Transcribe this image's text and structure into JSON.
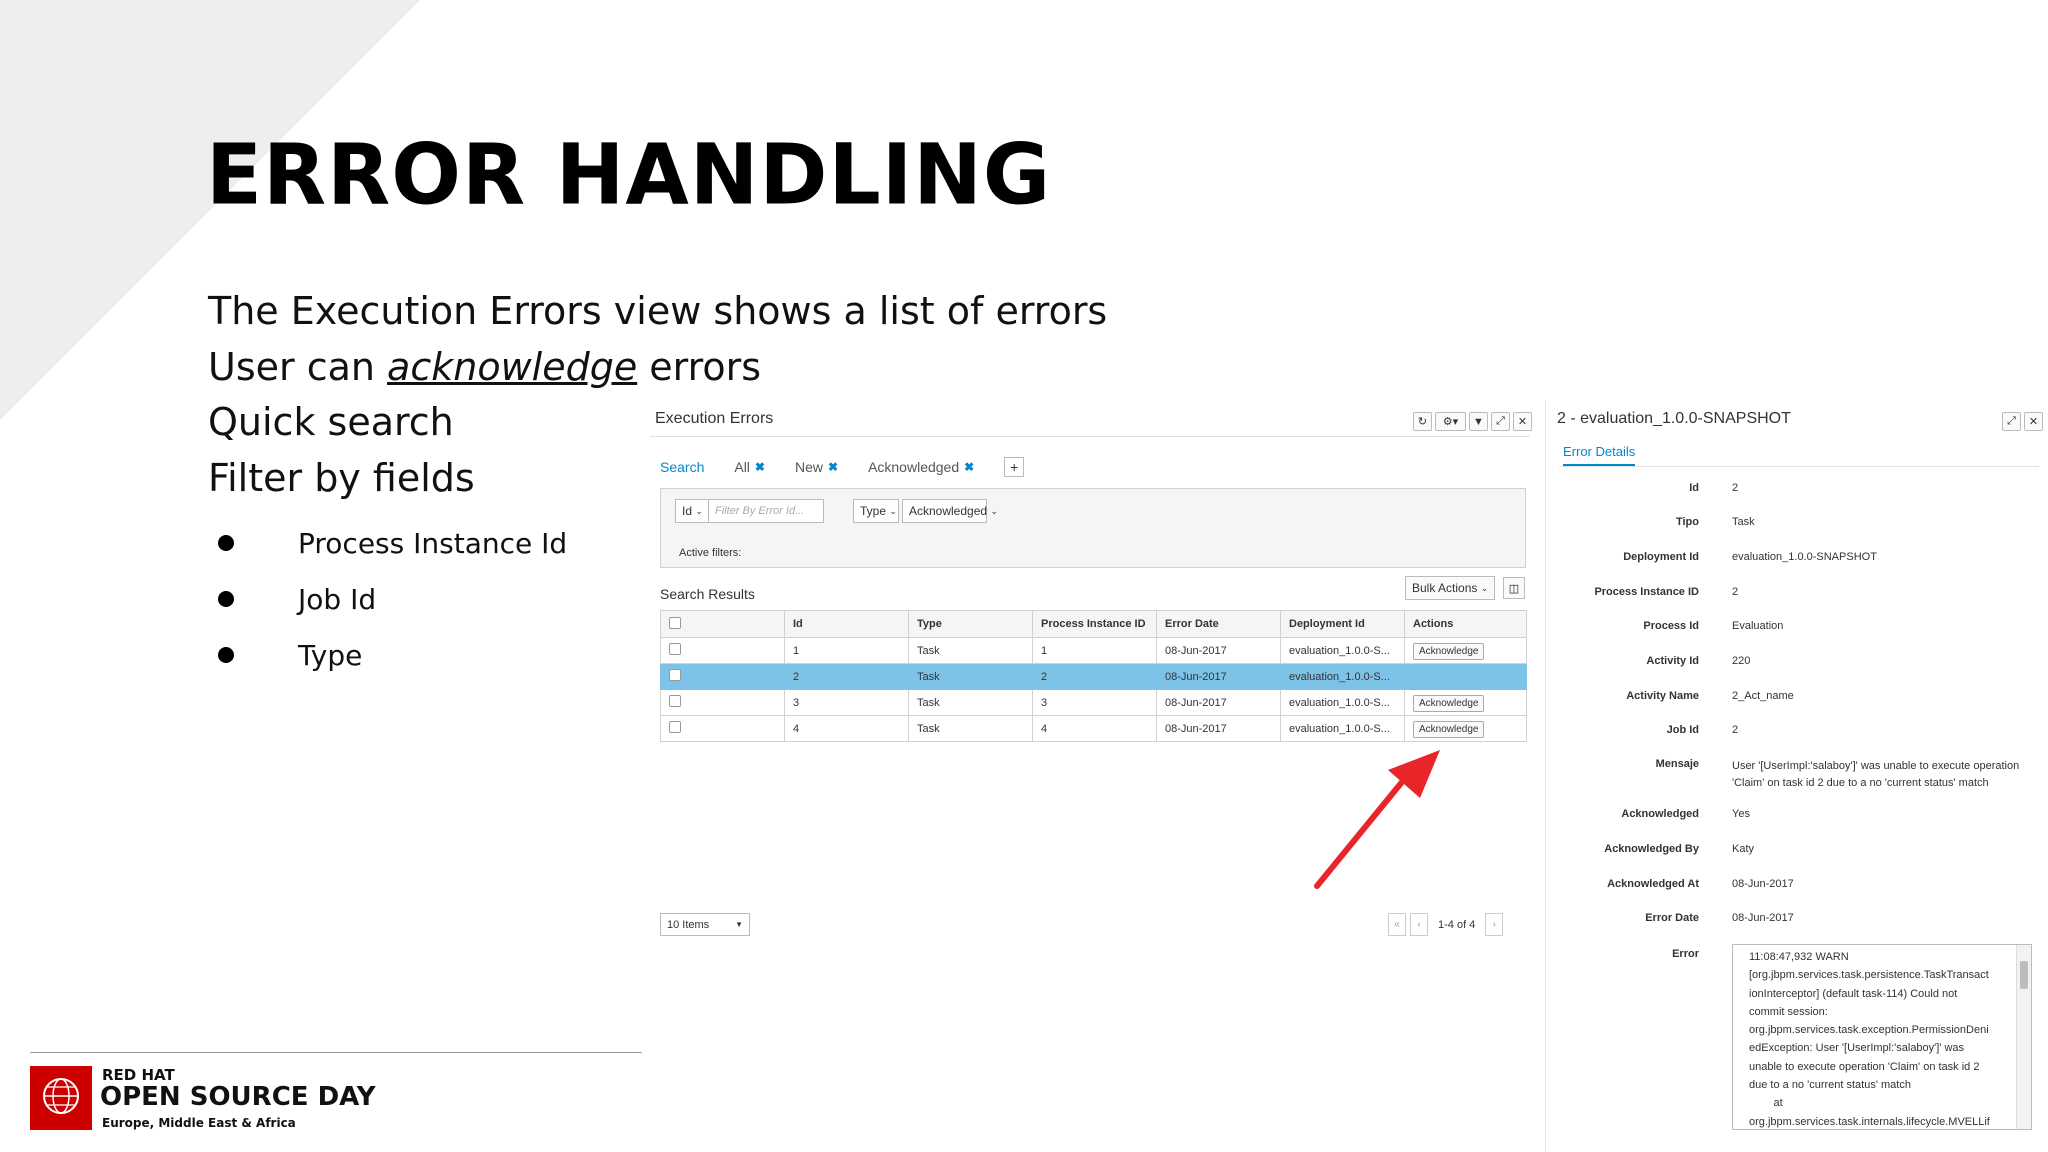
{
  "slide": {
    "title": "ERROR HANDLING",
    "bullet1": "The Execution Errors view shows a list of errors",
    "bullet2_pre": "User can ",
    "bullet2_em": "acknowledge",
    "bullet2_post": " errors",
    "bullet3": "Quick search",
    "bullet4": "Filter by fields",
    "sub_bullets": [
      "Process Instance Id",
      "Job Id",
      "Type"
    ]
  },
  "errors_panel": {
    "title": "Execution Errors",
    "tool_icons": [
      "refresh-icon",
      "gear-icon",
      "filter-icon",
      "expand-icon",
      "close-icon"
    ],
    "tabs": [
      {
        "label": "Search",
        "active": true,
        "closable": false
      },
      {
        "label": "All",
        "active": false,
        "closable": true
      },
      {
        "label": "New",
        "active": false,
        "closable": true
      },
      {
        "label": "Acknowledged",
        "active": false,
        "closable": true
      }
    ],
    "add_tab_label": "+",
    "filter": {
      "field_select": "Id",
      "input_placeholder": "Filter By Error Id...",
      "type_select": "Type",
      "ack_select": "Acknowledged",
      "active_filters_label": "Active filters:"
    },
    "search_results_label": "Search Results",
    "bulk_actions_label": "Bulk Actions",
    "columns": [
      "",
      "Id",
      "Type",
      "Process Instance ID",
      "Error Date",
      "Deployment Id",
      "Actions"
    ],
    "rows": [
      {
        "id": "1",
        "type": "Task",
        "pid": "1",
        "date": "08-Jun-2017",
        "deployment": "evaluation_1.0.0-S...",
        "action": "Acknowledge",
        "selected": false
      },
      {
        "id": "2",
        "type": "Task",
        "pid": "2",
        "date": "08-Jun-2017",
        "deployment": "evaluation_1.0.0-S...",
        "action": "",
        "selected": true
      },
      {
        "id": "3",
        "type": "Task",
        "pid": "3",
        "date": "08-Jun-2017",
        "deployment": "evaluation_1.0.0-S...",
        "action": "Acknowledge",
        "selected": false
      },
      {
        "id": "4",
        "type": "Task",
        "pid": "4",
        "date": "08-Jun-2017",
        "deployment": "evaluation_1.0.0-S...",
        "action": "Acknowledge",
        "selected": false
      }
    ],
    "page_size": "10 Items",
    "page_info": "1-4 of 4"
  },
  "details_panel": {
    "title": "2 - evaluation_1.0.0-SNAPSHOT",
    "tab": "Error Details",
    "fields": [
      {
        "label": "Id",
        "value": "2"
      },
      {
        "label": "Tipo",
        "value": "Task"
      },
      {
        "label": "Deployment Id",
        "value": "evaluation_1.0.0-SNAPSHOT"
      },
      {
        "label": "Process Instance ID",
        "value": "2"
      },
      {
        "label": "Process Id",
        "value": "Evaluation"
      },
      {
        "label": "Activity Id",
        "value": "220"
      },
      {
        "label": "Activity Name",
        "value": "2_Act_name"
      },
      {
        "label": "Job Id",
        "value": "2"
      },
      {
        "label": "Mensaje",
        "value": "User '[UserImpl:'salaboy']' was unable to execute operation 'Claim' on task id 2 due to a no 'current status' match"
      },
      {
        "label": "Acknowledged",
        "value": "Yes"
      },
      {
        "label": "Acknowledged By",
        "value": "Katy"
      },
      {
        "label": "Acknowledged At",
        "value": "08-Jun-2017"
      },
      {
        "label": "Error Date",
        "value": "08-Jun-2017"
      },
      {
        "label": "Error",
        "value": ""
      }
    ],
    "error_text": "11:08:47,932 WARN\n[org.jbpm.services.task.persistence.TaskTransact\nionInterceptor] (default task-114) Could not\ncommit session:\norg.jbpm.services.task.exception.PermissionDeni\nedException: User '[UserImpl:'salaboy']' was\nunable to execute operation 'Claim' on task id 2\ndue to a no 'current status' match\n        at\norg.jbpm.services.task.internals.lifecycle.MVELLif"
  },
  "footer": {
    "brand_line1": "RED HAT",
    "brand_line2": "OPEN SOURCE DAY",
    "brand_line3": "Europe, Middle East & Africa"
  },
  "colors": {
    "accent": "#0088ce",
    "selected_row": "#7dc3e8",
    "arrow": "#e8262a",
    "brand": "#cc0000"
  }
}
